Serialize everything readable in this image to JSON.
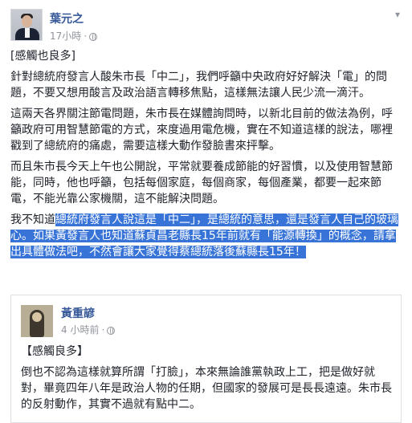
{
  "post": {
    "author": "葉元之",
    "time": "17小時",
    "separator": "·",
    "privacy_icon": "globe-icon",
    "menu_icon": "chevron-down-icon",
    "paragraphs": {
      "p1": "[感觸也良多]",
      "p2": "針對總統府發言人酸朱市長「中二」，我們呼籲中央政府好好解決「電」的問題，不要又想用酸言及政治語言轉移焦點，這樣無法讓人民少流一滴汗。",
      "p3": "這兩天各界關注節電問題，朱市長在媒體詢問時，以新北目前的做法為例，呼籲政府可用智慧節電的方式，來度過用電危機，實在不知道這樣的說法，哪裡戳到了總統府的痛處，需要這樣大動作發臉書來抨擊。",
      "p4": "而且朱市長今天上午也公開說，平常就要養成節能的好習慣，以及使用智慧節能，同時，他也呼籲，包括每個家庭，每個商家，每個產業，都要一起來節電，不能光靠公家機關，這不能解決問題。",
      "p5_plain": "我不知道",
      "p5_highlighted": "總統府發言人說這是「中二」，是總統的意思，還是發言人自己的玻璃心。如果黃發言人也知道蘇貞昌老縣長15年前就有「能源轉換」的概念，請拿出具體做法吧，不然會讓大家覺得蔡總統落後蘇縣長15年！"
    }
  },
  "shared_post": {
    "author": "黃重諺",
    "time": "4 小時前",
    "separator": "·",
    "privacy_icon": "globe-icon",
    "paragraphs": {
      "p1": "【感觸良多】",
      "p2": "倒也不認為這樣就算所謂「打臉」，本來無論誰黨執政上工，把是做好就對，畢竟四年八年是政治人物的任期，但國家的發展可是長長遠遠。朱市長的反射動作，其實不過就有點中二。"
    }
  },
  "colors": {
    "author_link": "#365899",
    "meta": "#90949c",
    "selection_highlight": "#3874d8"
  }
}
